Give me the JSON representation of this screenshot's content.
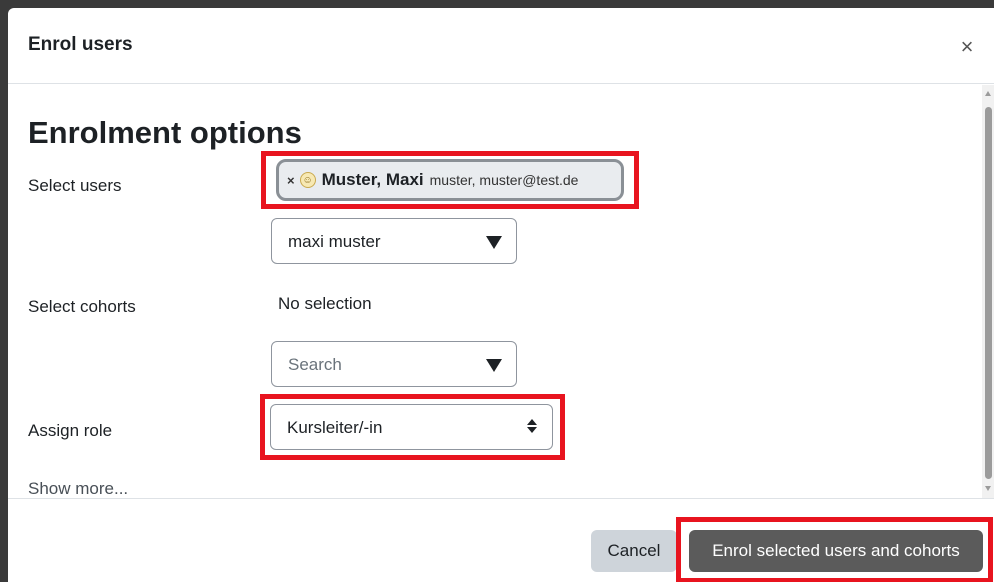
{
  "modal": {
    "title": "Enrol users",
    "close_icon": "close-icon",
    "section_heading": "Enrolment options"
  },
  "select_users": {
    "label": "Select users",
    "chip": {
      "remove_glyph": "×",
      "avatar_icon": "user-avatar-icon",
      "name": "Muster, Maxi",
      "detail": "muster, muster@test.de"
    },
    "search_value": "maxi muster"
  },
  "select_cohorts": {
    "label": "Select cohorts",
    "status": "No selection",
    "placeholder": "Search"
  },
  "assign_role": {
    "label": "Assign role",
    "value": "Kursleiter/-in"
  },
  "show_more": "Show more...",
  "footer": {
    "cancel_label": "Cancel",
    "submit_label": "Enrol selected users and cohorts"
  },
  "colors": {
    "highlight": "#e8141f",
    "primary_button": "#5b5b5b",
    "secondary_button": "#ced4da"
  }
}
